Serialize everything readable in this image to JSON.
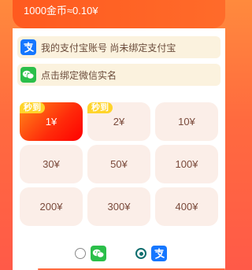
{
  "header": {
    "rate_text": "1000金币≈0.10¥"
  },
  "accounts": {
    "alipay": {
      "icon": "alipay-icon",
      "label": "我的支付宝账号 尚未绑定支付宝"
    },
    "wechat": {
      "icon": "wechat-icon",
      "label": "点击绑定微信实名"
    }
  },
  "amounts": [
    {
      "label": "1¥",
      "badge": "秒到",
      "selected": true
    },
    {
      "label": "2¥",
      "badge": "秒到",
      "selected": false
    },
    {
      "label": "10¥",
      "badge": "",
      "selected": false
    },
    {
      "label": "30¥",
      "badge": "",
      "selected": false
    },
    {
      "label": "50¥",
      "badge": "",
      "selected": false
    },
    {
      "label": "100¥",
      "badge": "",
      "selected": false
    },
    {
      "label": "200¥",
      "badge": "",
      "selected": false
    },
    {
      "label": "300¥",
      "badge": "",
      "selected": false
    },
    {
      "label": "400¥",
      "badge": "",
      "selected": false
    }
  ],
  "payment_method": {
    "options": [
      {
        "name": "wechat",
        "icon": "wechat-icon",
        "checked": false
      },
      {
        "name": "alipay",
        "icon": "alipay-icon",
        "checked": true
      }
    ]
  },
  "colors": {
    "accent": "#ff5a1f",
    "alipay": "#1677ff",
    "wechat": "#2bbf4a",
    "selected_radio": "#0e6e6e"
  }
}
